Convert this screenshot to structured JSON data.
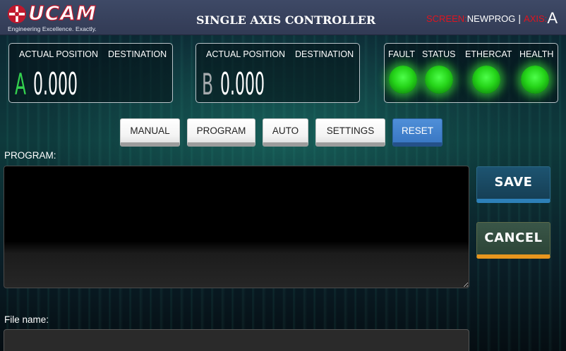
{
  "header": {
    "logo_text": "UCAM",
    "logo_tagline": "Engineering Excellence. Exactly.",
    "title": "SINGLE AXIS CONTROLLER",
    "screen_label": "SCREEN:",
    "screen_value": "NEWPROG",
    "separator": "|",
    "axis_label": "AXIS:",
    "axis_value": "A"
  },
  "axis_panels": [
    {
      "letter": "A",
      "actual_position_label": "ACTUAL POSITION",
      "destination_label": "DESTINATION",
      "value": "0.000",
      "letter_color": "#33d14e"
    },
    {
      "letter": "B",
      "actual_position_label": "ACTUAL POSITION",
      "destination_label": "DESTINATION",
      "value": "0.000",
      "letter_color": "#a7abae"
    }
  ],
  "status_panel": {
    "indicators": [
      {
        "label": "FAULT",
        "state": "on",
        "color": "#25d419"
      },
      {
        "label": "STATUS",
        "state": "on",
        "color": "#25d419"
      },
      {
        "label": "ETHERCAT",
        "state": "on",
        "color": "#25d419"
      },
      {
        "label": "HEALTH",
        "state": "on",
        "color": "#25d419"
      }
    ]
  },
  "mode_buttons": [
    {
      "label": "MANUAL",
      "active": false
    },
    {
      "label": "PROGRAM",
      "active": false
    },
    {
      "label": "AUTO",
      "active": false
    },
    {
      "label": "SETTINGS",
      "active": false
    },
    {
      "label": "RESET",
      "active": true
    }
  ],
  "program": {
    "label": "PROGRAM:",
    "value": ""
  },
  "actions": {
    "save_label": "SAVE",
    "cancel_label": "CANCEL"
  },
  "file": {
    "label": "File name:",
    "value": ""
  },
  "colors": {
    "header_bg": "#363f5b",
    "accent_red": "#e0141f",
    "led_green": "#25d419",
    "axis_a": "#33d14e",
    "reset_blue": "#3a78c4",
    "save_accent": "#2d80b8",
    "cancel_accent": "#e8961e"
  }
}
